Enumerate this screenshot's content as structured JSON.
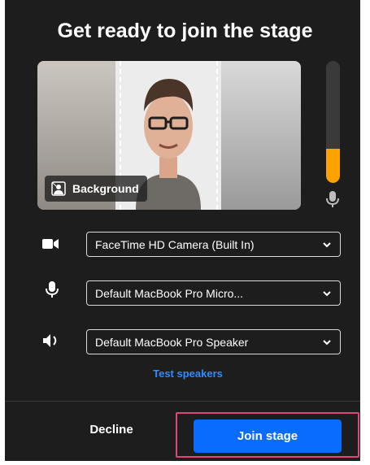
{
  "dialog": {
    "title": "Get ready to join the stage"
  },
  "preview": {
    "background_button_label": "Background"
  },
  "mic_level": {
    "fraction": 0.28,
    "color": "#ffa200"
  },
  "devices": {
    "camera": {
      "selected": "FaceTime HD Camera (Built In)",
      "icon": "video-camera-icon"
    },
    "microphone": {
      "selected": "Default MacBook Pro Micro...",
      "icon": "microphone-icon"
    },
    "speaker": {
      "selected": "Default MacBook Pro Speaker",
      "icon": "speaker-icon"
    }
  },
  "test_speakers_label": "Test speakers",
  "footer": {
    "decline_label": "Decline",
    "join_label": "Join stage"
  },
  "colors": {
    "accent": "#0a6cff",
    "link": "#2f8cff",
    "highlight": "#e0467c",
    "background": "#1d1d1d"
  }
}
